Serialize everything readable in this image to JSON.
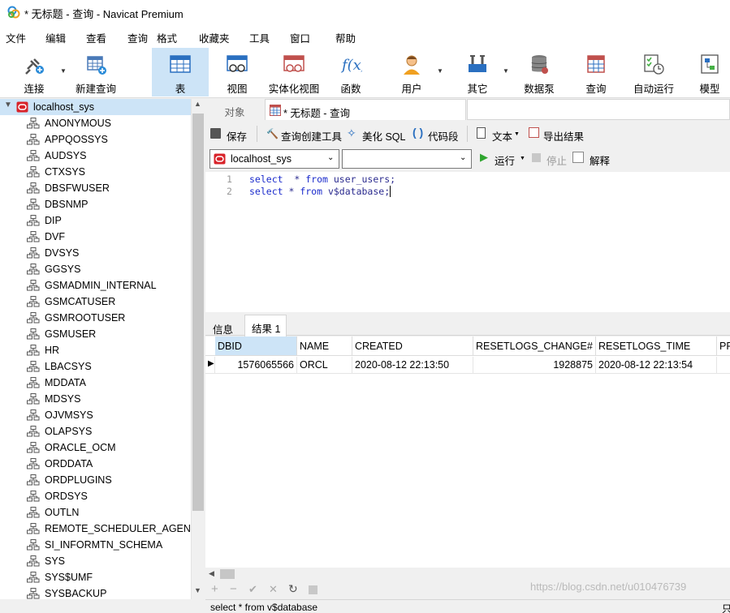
{
  "window": {
    "title": "* 无标题 - 查询 - Navicat Premium"
  },
  "menu": [
    "文件",
    "编辑",
    "查看",
    "查询",
    "格式",
    "收藏夹",
    "工具",
    "窗口",
    "帮助"
  ],
  "toolbar": {
    "connect": "连接",
    "new_query": "新建查询",
    "table": "表",
    "view": "视图",
    "materialized_view": "实体化视图",
    "function": "函数",
    "user": "用户",
    "other": "其它",
    "data_pump": "数据泵",
    "query": "查询",
    "auto_run": "自动运行",
    "model": "模型"
  },
  "sidebar": {
    "connection": "localhost_sys",
    "schemas": [
      "ANONYMOUS",
      "APPQOSSYS",
      "AUDSYS",
      "CTXSYS",
      "DBSFWUSER",
      "DBSNMP",
      "DIP",
      "DVF",
      "DVSYS",
      "GGSYS",
      "GSMADMIN_INTERNAL",
      "GSMCATUSER",
      "GSMROOTUSER",
      "GSMUSER",
      "HR",
      "LBACSYS",
      "MDDATA",
      "MDSYS",
      "OJVMSYS",
      "OLAPSYS",
      "ORACLE_OCM",
      "ORDDATA",
      "ORDPLUGINS",
      "ORDSYS",
      "OUTLN",
      "REMOTE_SCHEDULER_AGENT",
      "SI_INFORMTN_SCHEMA",
      "SYS",
      "SYS$UMF",
      "SYSBACKUP"
    ]
  },
  "tabs": {
    "objects": "对象",
    "query_tab": "* 无标题 - 查询"
  },
  "query_toolbar": {
    "save": "保存",
    "query_builder": "查询创建工具",
    "beautify": "美化 SQL",
    "snippet": "代码段",
    "text": "文本",
    "export": "导出结果"
  },
  "connection_row": {
    "connection": "localhost_sys",
    "schema": "",
    "run": "运行",
    "stop": "停止",
    "explain": "解释"
  },
  "editor": {
    "lines": [
      {
        "num": "1",
        "kw1": "select",
        "mid": "  * ",
        "kw2": "from",
        "rest": " user_users;"
      },
      {
        "num": "2",
        "kw1": "select",
        "mid": " * ",
        "kw2": "from",
        "rest": " v$database;"
      }
    ]
  },
  "result_tabs": {
    "info": "信息",
    "result1": "结果 1"
  },
  "grid": {
    "columns": [
      "DBID",
      "NAME",
      "CREATED",
      "RESETLOGS_CHANGE#",
      "RESETLOGS_TIME",
      "PR"
    ],
    "rows": [
      [
        "1576065566",
        "ORCL",
        "2020-08-12 22:13:50",
        "1928875",
        "2020-08-12 22:13:54",
        ""
      ]
    ]
  },
  "status": {
    "sql": "select * from v$database",
    "watermark": "https://blog.csdn.net/u010476739",
    "right_char": "只"
  },
  "colors": {
    "accent": "#cde4f7",
    "oracle_red": "#d8232a",
    "keyword": "#1b2bcc"
  }
}
